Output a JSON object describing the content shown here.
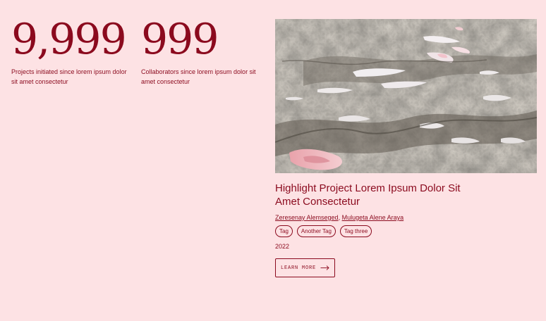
{
  "stats": [
    {
      "number": "9,999",
      "description": "Projects initiated since lorem ipsum dolor sit amet consectetur"
    },
    {
      "number": "999",
      "description": "Collaborators since lorem ipsum dolor sit amet consectetur"
    }
  ],
  "project": {
    "image_alt": "satellite-terrain-image",
    "title": "Highlight Project Lorem Ipsum Dolor Sit Amet Consectetur",
    "authors": [
      "Zeresenay Alemseged",
      "Mulugeta Alene Araya"
    ],
    "author_separator": ",",
    "tags": [
      "Tag",
      "Another Tag",
      "Tag three"
    ],
    "year": "2022",
    "cta_label": "LEARN MORE",
    "cta_icon": "arrow-right-icon"
  },
  "colors": {
    "background": "#fde2e4",
    "accent": "#8b0a1e"
  }
}
